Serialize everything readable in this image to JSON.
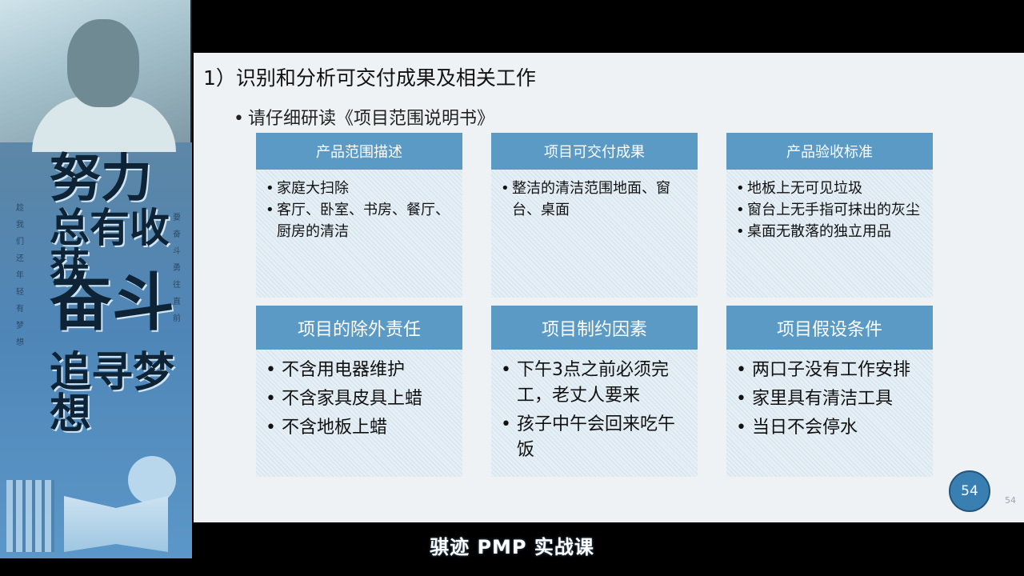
{
  "poster": {
    "line1": "努力",
    "line2": "总有收获",
    "line3": "奋斗",
    "line4": "追寻梦想",
    "col_left": "趁我们还年轻有梦想",
    "col_right": "要奋斗勇往直前"
  },
  "slide": {
    "title": "1）识别和分析可交付成果及相关工作",
    "bullet": "请仔细研读《项目范围说明书》",
    "page_badge": "54",
    "page_number": "54",
    "cards_top": [
      {
        "heading": "产品范围描述",
        "items": [
          "家庭大扫除",
          "客厅、卧室、书房、餐厅、厨房的清洁"
        ]
      },
      {
        "heading": "项目可交付成果",
        "items": [
          "整洁的清洁范围地面、窗台、桌面"
        ]
      },
      {
        "heading": "产品验收标准",
        "items": [
          "地板上无可见垃圾",
          "窗台上无手指可抹出的灰尘",
          "桌面无散落的独立用品"
        ]
      }
    ],
    "cards_bottom": [
      {
        "heading": "项目的除外责任",
        "items": [
          "不含用电器维护",
          "不含家具皮具上蜡",
          "不含地板上蜡"
        ]
      },
      {
        "heading": "项目制约因素",
        "items": [
          "下午3点之前必须完工，老丈人要来",
          "孩子中午会回来吃午饭"
        ]
      },
      {
        "heading": "项目假设条件",
        "items": [
          "两口子没有工作安排",
          "家里具有清洁工具",
          "当日不会停水"
        ]
      }
    ]
  },
  "caption": "骐迹 PMP 实战课",
  "colors": {
    "card_header": "#5b9ac4",
    "badge": "#3a7fb2",
    "slide_bg": "#eef2f5"
  }
}
